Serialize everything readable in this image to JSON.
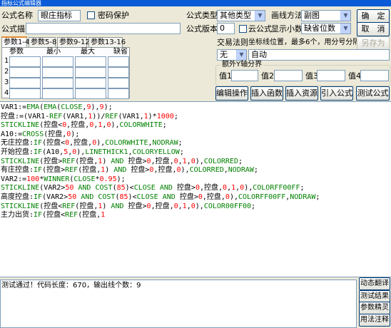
{
  "window": {
    "title": "指标公式编辑器"
  },
  "form": {
    "name_label": "公式名称",
    "name_value": "眼庄指标",
    "password_label": "密码保护",
    "desc_label": "公式描述",
    "desc_value": "",
    "type_label": "公式类型",
    "type_value": "其他类型",
    "draw_label": "画线方法",
    "draw_value": "副图",
    "version_label": "公式版本",
    "version_value": "0",
    "cloud_label": "云公式",
    "decimals_label": "显示小数",
    "decimals_value": "缺省位数",
    "trade_label": "交易法则",
    "coord_label": "坐标线位置，最多6个，用分号分隔",
    "trade_value": "无",
    "coord_value": "自动",
    "extra_y_label": "额外Y轴分界",
    "y_values": [
      {
        "label": "值1",
        "value": ""
      },
      {
        "label": "值2",
        "value": ""
      },
      {
        "label": "值3",
        "value": ""
      },
      {
        "label": "值4",
        "value": ""
      }
    ]
  },
  "buttons": {
    "ok": "确　定",
    "cancel": "取　消",
    "save_as": "另存为",
    "edit_ops": "编辑操作",
    "insert_func": "插入函数",
    "insert_resource": "插入资源",
    "import_formula": "引入公式",
    "test_formula": "测试公式"
  },
  "param_tabs": [
    "参数1-4",
    "参数5-8",
    "参数9-12",
    "参数13-16"
  ],
  "param_headers": [
    "参数",
    "最小",
    "最大",
    "缺省"
  ],
  "param_rows": [
    "1",
    "2",
    "3",
    "4"
  ],
  "code_lines": [
    {
      "segs": [
        {
          "t": "VAR1:=",
          "c": "black"
        },
        {
          "t": "EMA",
          "c": "green"
        },
        {
          "t": "(",
          "c": "black"
        },
        {
          "t": "EMA",
          "c": "green"
        },
        {
          "t": "(",
          "c": "black"
        },
        {
          "t": "CLOSE",
          "c": "green"
        },
        {
          "t": ",",
          "c": "black"
        },
        {
          "t": "9",
          "c": "red"
        },
        {
          "t": "),",
          "c": "black"
        },
        {
          "t": "9",
          "c": "red"
        },
        {
          "t": ");",
          "c": "black"
        }
      ]
    },
    {
      "segs": [
        {
          "t": "控盘:=(VAR1-",
          "c": "black"
        },
        {
          "t": "REF",
          "c": "green"
        },
        {
          "t": "(VAR1,",
          "c": "black"
        },
        {
          "t": "1",
          "c": "red"
        },
        {
          "t": "))/",
          "c": "black"
        },
        {
          "t": "REF",
          "c": "green"
        },
        {
          "t": "(VAR1,",
          "c": "black"
        },
        {
          "t": "1",
          "c": "red"
        },
        {
          "t": ")*",
          "c": "black"
        },
        {
          "t": "1000",
          "c": "red"
        },
        {
          "t": ";",
          "c": "black"
        }
      ]
    },
    {
      "segs": [
        {
          "t": "STICKLINE",
          "c": "green"
        },
        {
          "t": "(控盘<",
          "c": "black"
        },
        {
          "t": "0",
          "c": "red"
        },
        {
          "t": ",控盘,",
          "c": "black"
        },
        {
          "t": "0",
          "c": "red"
        },
        {
          "t": ",",
          "c": "black"
        },
        {
          "t": "1",
          "c": "red"
        },
        {
          "t": ",",
          "c": "black"
        },
        {
          "t": "0",
          "c": "red"
        },
        {
          "t": "),",
          "c": "black"
        },
        {
          "t": "COLORWHITE",
          "c": "green"
        },
        {
          "t": ";",
          "c": "black"
        }
      ]
    },
    {
      "segs": [
        {
          "t": "A10:=",
          "c": "black"
        },
        {
          "t": "CROSS",
          "c": "green"
        },
        {
          "t": "(控盘,",
          "c": "black"
        },
        {
          "t": "0",
          "c": "red"
        },
        {
          "t": ");",
          "c": "black"
        }
      ]
    },
    {
      "segs": [
        {
          "t": "无庄控盘:",
          "c": "black"
        },
        {
          "t": "IF",
          "c": "green"
        },
        {
          "t": "(控盘<",
          "c": "black"
        },
        {
          "t": "0",
          "c": "red"
        },
        {
          "t": ",控盘,",
          "c": "black"
        },
        {
          "t": "0",
          "c": "red"
        },
        {
          "t": "),",
          "c": "black"
        },
        {
          "t": "COLORWHITE",
          "c": "green"
        },
        {
          "t": ",",
          "c": "black"
        },
        {
          "t": "NODRAW",
          "c": "green"
        },
        {
          "t": ";",
          "c": "black"
        }
      ]
    },
    {
      "segs": [
        {
          "t": "开始控盘:",
          "c": "black"
        },
        {
          "t": "IF",
          "c": "green"
        },
        {
          "t": "(A10,",
          "c": "black"
        },
        {
          "t": "5",
          "c": "red"
        },
        {
          "t": ",",
          "c": "black"
        },
        {
          "t": "0",
          "c": "red"
        },
        {
          "t": "),",
          "c": "black"
        },
        {
          "t": "LINETHICK1",
          "c": "green"
        },
        {
          "t": ",",
          "c": "black"
        },
        {
          "t": "COLORYELLOW",
          "c": "green"
        },
        {
          "t": ";",
          "c": "black"
        }
      ]
    },
    {
      "segs": [
        {
          "t": "STICKLINE",
          "c": "green"
        },
        {
          "t": "(控盘>",
          "c": "black"
        },
        {
          "t": "REF",
          "c": "green"
        },
        {
          "t": "(控盘,",
          "c": "black"
        },
        {
          "t": "1",
          "c": "red"
        },
        {
          "t": ") ",
          "c": "black"
        },
        {
          "t": "AND",
          "c": "green"
        },
        {
          "t": " 控盘>",
          "c": "black"
        },
        {
          "t": "0",
          "c": "red"
        },
        {
          "t": ",控盘,",
          "c": "black"
        },
        {
          "t": "0",
          "c": "red"
        },
        {
          "t": ",",
          "c": "black"
        },
        {
          "t": "1",
          "c": "red"
        },
        {
          "t": ",",
          "c": "black"
        },
        {
          "t": "0",
          "c": "red"
        },
        {
          "t": "),",
          "c": "black"
        },
        {
          "t": "COLORRED",
          "c": "green"
        },
        {
          "t": ";",
          "c": "black"
        }
      ]
    },
    {
      "segs": [
        {
          "t": "有庄控盘:",
          "c": "black"
        },
        {
          "t": "IF",
          "c": "green"
        },
        {
          "t": "(控盘>",
          "c": "black"
        },
        {
          "t": "REF",
          "c": "green"
        },
        {
          "t": "(控盘,",
          "c": "black"
        },
        {
          "t": "1",
          "c": "red"
        },
        {
          "t": ") ",
          "c": "black"
        },
        {
          "t": "AND",
          "c": "green"
        },
        {
          "t": " 控盘>",
          "c": "black"
        },
        {
          "t": "0",
          "c": "red"
        },
        {
          "t": ",控盘,",
          "c": "black"
        },
        {
          "t": "0",
          "c": "red"
        },
        {
          "t": "),",
          "c": "black"
        },
        {
          "t": "COLORRED",
          "c": "green"
        },
        {
          "t": ",",
          "c": "black"
        },
        {
          "t": "NODRAW",
          "c": "green"
        },
        {
          "t": ";",
          "c": "black"
        }
      ]
    },
    {
      "segs": [
        {
          "t": "VAR2:=",
          "c": "black"
        },
        {
          "t": "100",
          "c": "red"
        },
        {
          "t": "*",
          "c": "black"
        },
        {
          "t": "WINNER",
          "c": "green"
        },
        {
          "t": "(",
          "c": "black"
        },
        {
          "t": "CLOSE",
          "c": "green"
        },
        {
          "t": "*",
          "c": "black"
        },
        {
          "t": "0.95",
          "c": "red"
        },
        {
          "t": ");",
          "c": "black"
        }
      ]
    },
    {
      "segs": [
        {
          "t": "STICKLINE",
          "c": "green"
        },
        {
          "t": "(VAR2>",
          "c": "black"
        },
        {
          "t": "50",
          "c": "red"
        },
        {
          "t": " ",
          "c": "black"
        },
        {
          "t": "AND",
          "c": "green"
        },
        {
          "t": " ",
          "c": "black"
        },
        {
          "t": "COST",
          "c": "green"
        },
        {
          "t": "(",
          "c": "black"
        },
        {
          "t": "85",
          "c": "red"
        },
        {
          "t": ")<",
          "c": "black"
        },
        {
          "t": "CLOSE",
          "c": "green"
        },
        {
          "t": " ",
          "c": "black"
        },
        {
          "t": "AND",
          "c": "green"
        },
        {
          "t": " 控盘>",
          "c": "black"
        },
        {
          "t": "0",
          "c": "red"
        },
        {
          "t": ",控盘,",
          "c": "black"
        },
        {
          "t": "0",
          "c": "red"
        },
        {
          "t": ",",
          "c": "black"
        },
        {
          "t": "1",
          "c": "red"
        },
        {
          "t": ",",
          "c": "black"
        },
        {
          "t": "0",
          "c": "red"
        },
        {
          "t": "),",
          "c": "black"
        },
        {
          "t": "COLORFF00FF",
          "c": "green"
        },
        {
          "t": ";",
          "c": "black"
        }
      ]
    },
    {
      "segs": [
        {
          "t": "高度控盘:",
          "c": "black"
        },
        {
          "t": "IF",
          "c": "green"
        },
        {
          "t": "(VAR2>",
          "c": "black"
        },
        {
          "t": "50",
          "c": "red"
        },
        {
          "t": " ",
          "c": "black"
        },
        {
          "t": "AND",
          "c": "green"
        },
        {
          "t": " ",
          "c": "black"
        },
        {
          "t": "COST",
          "c": "green"
        },
        {
          "t": "(",
          "c": "black"
        },
        {
          "t": "85",
          "c": "red"
        },
        {
          "t": ")<",
          "c": "black"
        },
        {
          "t": "CLOSE",
          "c": "green"
        },
        {
          "t": " ",
          "c": "black"
        },
        {
          "t": "AND",
          "c": "green"
        },
        {
          "t": " 控盘>",
          "c": "black"
        },
        {
          "t": "0",
          "c": "red"
        },
        {
          "t": ",控盘,",
          "c": "black"
        },
        {
          "t": "0",
          "c": "red"
        },
        {
          "t": "),",
          "c": "black"
        },
        {
          "t": "COLORFF00FF",
          "c": "green"
        },
        {
          "t": ",",
          "c": "black"
        },
        {
          "t": "NODRAW",
          "c": "green"
        },
        {
          "t": ";",
          "c": "black"
        }
      ]
    },
    {
      "segs": [
        {
          "t": "STICKLINE",
          "c": "green"
        },
        {
          "t": "(控盘<",
          "c": "black"
        },
        {
          "t": "REF",
          "c": "green"
        },
        {
          "t": "(控盘,",
          "c": "black"
        },
        {
          "t": "1",
          "c": "red"
        },
        {
          "t": ") ",
          "c": "black"
        },
        {
          "t": "AND",
          "c": "green"
        },
        {
          "t": " 控盘>",
          "c": "black"
        },
        {
          "t": "0",
          "c": "red"
        },
        {
          "t": ",控盘,",
          "c": "black"
        },
        {
          "t": "0",
          "c": "red"
        },
        {
          "t": ",",
          "c": "black"
        },
        {
          "t": "1",
          "c": "red"
        },
        {
          "t": ",",
          "c": "black"
        },
        {
          "t": "0",
          "c": "red"
        },
        {
          "t": "),",
          "c": "black"
        },
        {
          "t": "COLOR00FF00",
          "c": "green"
        },
        {
          "t": ";",
          "c": "black"
        }
      ]
    },
    {
      "segs": [
        {
          "t": "主力出货:",
          "c": "black"
        },
        {
          "t": "IF",
          "c": "green"
        },
        {
          "t": "(控盘<",
          "c": "black"
        },
        {
          "t": "REF",
          "c": "green"
        },
        {
          "t": "(控盘,",
          "c": "black"
        },
        {
          "t": "1",
          "c": "red"
        }
      ]
    }
  ],
  "status": {
    "text": "测试通过！代码长度：670，输出线个数：9"
  },
  "side_buttons": {
    "dynamic": "动态翻译",
    "test_result": "测试结果",
    "param_wizard": "参数精灵",
    "usage": "用法注释"
  },
  "colors": {
    "titlebar": "#0a5bd8",
    "window_bg": "#ece9d8",
    "code_green": "#008000",
    "code_red": "#ff0000"
  }
}
